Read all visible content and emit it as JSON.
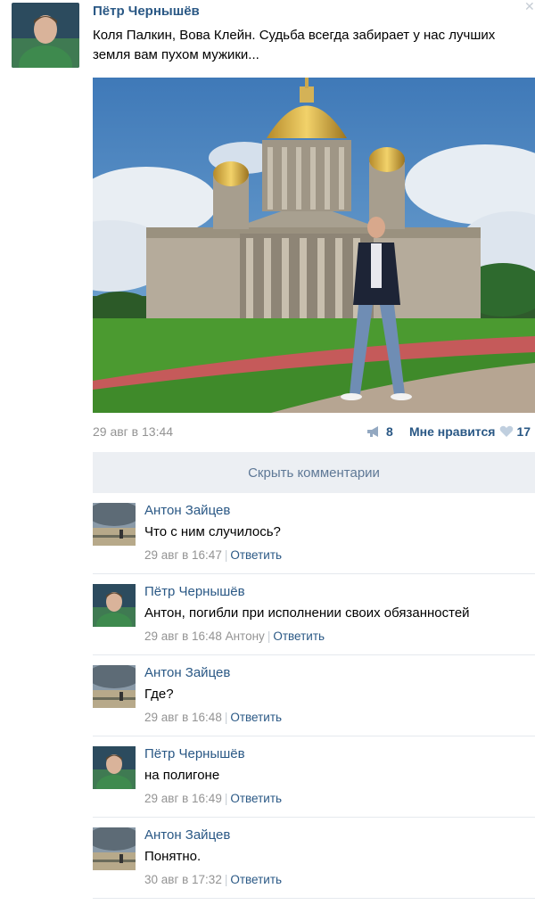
{
  "post": {
    "author": "Пётр Чернышёв",
    "text": "Коля Палкин, Вова Клейн. Судьба всегда забирает у нас лучших земля вам пухом мужики...",
    "date": "29 авг в 13:44",
    "shares": "8",
    "like_label": "Мне нравится",
    "likes": "17",
    "close_icon": "close-icon",
    "colors": {
      "link": "#2a5885",
      "meta": "#939393",
      "panel": "#eceff3"
    }
  },
  "hide_comments_label": "Скрыть комментарии",
  "comments": [
    {
      "author": "Антон Зайцев",
      "text": "Что с ним случилось?",
      "date": "29 авг в 16:47",
      "reply_to": "",
      "reply_label": "Ответить"
    },
    {
      "author": "Пётр Чернышёв",
      "text": "Антон, погибли при исполнении своих обязанностей",
      "date": "29 авг в 16:48",
      "reply_to": "Антону",
      "reply_label": "Ответить"
    },
    {
      "author": "Антон Зайцев",
      "text": "Где?",
      "date": "29 авг в 16:48",
      "reply_to": "",
      "reply_label": "Ответить"
    },
    {
      "author": "Пётр Чернышёв",
      "text": "на полигоне",
      "date": "29 авг в 16:49",
      "reply_to": "",
      "reply_label": "Ответить"
    },
    {
      "author": "Антон Зайцев",
      "text": "Понятно.",
      "date": "30 авг в 17:32",
      "reply_to": "",
      "reply_label": "Ответить"
    }
  ]
}
